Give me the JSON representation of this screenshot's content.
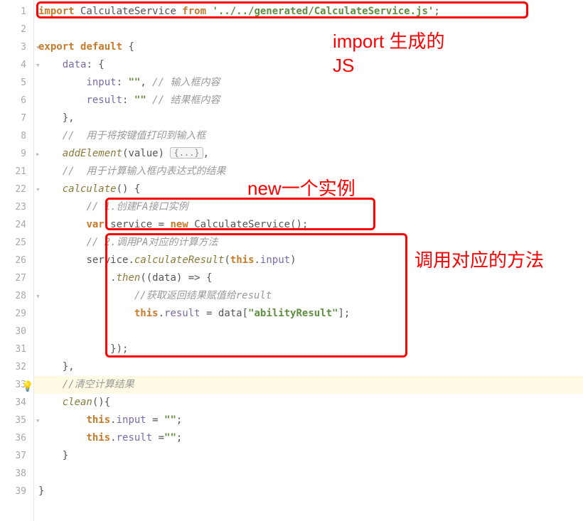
{
  "gutter": {
    "numbers": [
      "1",
      "2",
      "3",
      "4",
      "5",
      "6",
      "7",
      "8",
      "9",
      "21",
      "22",
      "23",
      "24",
      "25",
      "26",
      "27",
      "28",
      "29",
      "30",
      "31",
      "32",
      "33",
      "34",
      "35",
      "36",
      "37",
      "38",
      "39"
    ]
  },
  "annotations": {
    "a1": "import 生成的\nJS",
    "a2": "new一个实例",
    "a3": "调用对应的方法"
  },
  "code": {
    "l1": {
      "kw1": "import",
      "cls": " CalculateService ",
      "kw2": "from ",
      "str": "'../../generated/CalculateService.js'",
      "pn": ";"
    },
    "l3": {
      "kw1": "export ",
      "kw2": "default ",
      "pn": "{"
    },
    "l4": {
      "prop": "data",
      "pn": ": {"
    },
    "l5": {
      "prop": "input",
      "pn1": ": ",
      "str": "\"\"",
      "pn2": ", ",
      "cmt": "// 输入框内容"
    },
    "l6": {
      "prop": "result",
      "pn1": ": ",
      "str": "\"\"",
      "cmt": " // 结果框内容"
    },
    "l7": {
      "pn": "},"
    },
    "l8": {
      "cmt": "//  用于将按键值打印到输入框"
    },
    "l9": {
      "fn": "addElement",
      "pn1": "(",
      "param": "value",
      "pn2": ") ",
      "fold": "{...}",
      "pn3": ","
    },
    "l21": {
      "cmt": "//  用于计算输入框内表达式的结果"
    },
    "l22": {
      "fn": "calculate",
      "pn": "() {"
    },
    "l23": {
      "cmt": "// 1.创建FA接口实例"
    },
    "l24": {
      "kw1": "var ",
      "id": "service",
      "pn1": " = ",
      "kw2": "new ",
      "cls": "CalculateService",
      "pn2": "();"
    },
    "l25": {
      "cmt": "// 2.调用PA对应的计算方法"
    },
    "l26": {
      "id": "service",
      "pn1": ".",
      "fn": "calculateResult",
      "pn2": "(",
      "kw": "this",
      "pn3": ".",
      "prop": "input",
      "pn4": ")"
    },
    "l27": {
      "pn1": ".",
      "fn": "then",
      "pn2": "((",
      "param": "data",
      "pn3": ") => {"
    },
    "l28": {
      "cmt": "//获取返回结果赋值给result"
    },
    "l29": {
      "kw": "this",
      "pn1": ".",
      "prop": "result",
      "pn2": " = ",
      "id": "data",
      "pn3": "[",
      "str": "\"abilityResult\"",
      "pn4": "];"
    },
    "l31": {
      "pn": "});"
    },
    "l32": {
      "pn": "},"
    },
    "l33": {
      "cmt": "//清空计算结果"
    },
    "l34": {
      "fn": "clean",
      "pn": "(){"
    },
    "l35": {
      "kw": "this",
      "pn1": ".",
      "prop": "input",
      "pn2": " = ",
      "str": "\"\"",
      "pn3": ";"
    },
    "l36": {
      "kw": "this",
      "pn1": ".",
      "prop": "result",
      "pn2": " =",
      "str": "\"\"",
      "pn3": ";"
    },
    "l37": {
      "pn": "}"
    },
    "l38": {
      "pn": "}"
    }
  }
}
